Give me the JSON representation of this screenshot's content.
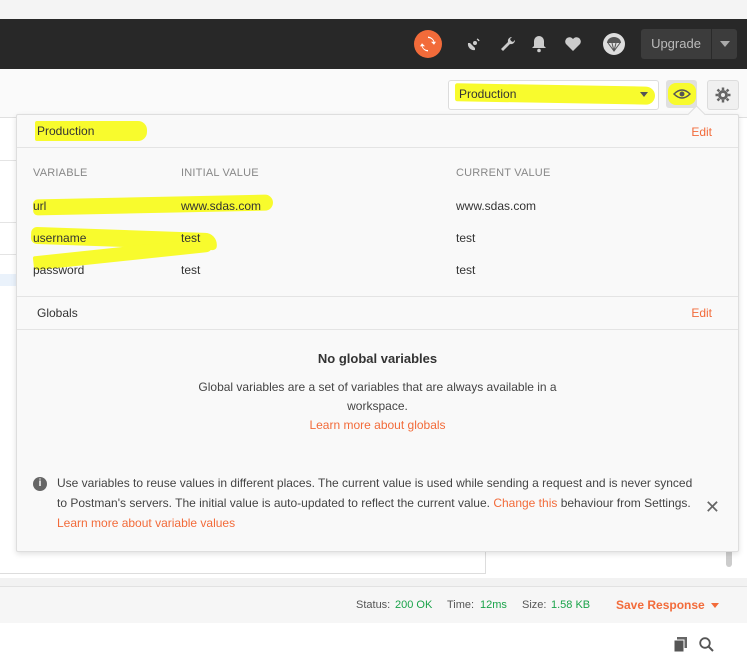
{
  "topbar": {
    "upgrade_label": "Upgrade",
    "icons": [
      "sync-icon",
      "satellite-icon",
      "wrench-icon",
      "bell-icon",
      "heart-icon",
      "parachute-icon"
    ],
    "accent": "#f26b3a"
  },
  "environment": {
    "selected": "Production",
    "highlight_color": "#f8fb2d"
  },
  "popover": {
    "env_section": {
      "title": "Production",
      "edit_label": "Edit",
      "columns": [
        "VARIABLE",
        "INITIAL VALUE",
        "CURRENT VALUE"
      ],
      "rows": [
        {
          "variable": "url",
          "initial": "www.sdas.com",
          "current": "www.sdas.com"
        },
        {
          "variable": "username",
          "initial": "test",
          "current": "test"
        },
        {
          "variable": "password",
          "initial": "test",
          "current": "test"
        }
      ]
    },
    "globals_section": {
      "title": "Globals",
      "edit_label": "Edit",
      "empty_title": "No global variables",
      "empty_desc": "Global variables are a set of variables that are always available in a workspace.",
      "learn_link": "Learn more about globals"
    },
    "info": {
      "text_1": "Use variables to reuse values in different places. The current value is used while sending a request and is never synced to Postman's servers. The initial value is auto-updated to reflect the current value.",
      "change_link": "Change this",
      "text_2": "behaviour from Settings.",
      "learn_link": "Learn more about variable values"
    }
  },
  "status_bar": {
    "status_label": "Status:",
    "status_value": "200 OK",
    "time_label": "Time:",
    "time_value": "12ms",
    "size_label": "Size:",
    "size_value": "1.58 KB",
    "save_response": "Save Response"
  }
}
